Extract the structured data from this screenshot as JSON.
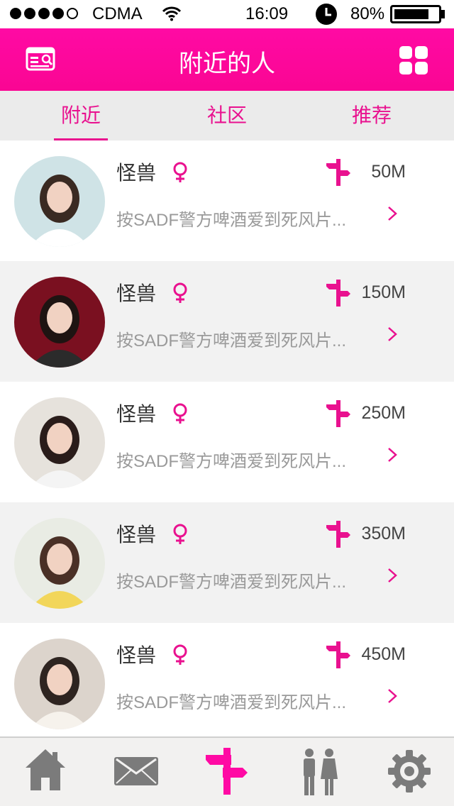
{
  "status_bar": {
    "carrier": "CDMA",
    "time": "16:09",
    "battery": "80%",
    "battery_level": 0.8,
    "signal_filled": 4,
    "signal_total": 5
  },
  "navbar": {
    "title": "附近的人",
    "left_icon": "id-card-icon",
    "right_icon": "grid-icon"
  },
  "tabs": [
    {
      "label": "附近",
      "active": true
    },
    {
      "label": "社区",
      "active": false
    },
    {
      "label": "推荐",
      "active": false
    }
  ],
  "list": [
    {
      "name": "怪兽",
      "gender": "female-icon",
      "distance": "50M",
      "desc": "按SADF警方啤酒爱到死风片..."
    },
    {
      "name": "怪兽",
      "gender": "female-icon",
      "distance": "150M",
      "desc": "按SADF警方啤酒爱到死风片..."
    },
    {
      "name": "怪兽",
      "gender": "female-icon",
      "distance": "250M",
      "desc": "按SADF警方啤酒爱到死风片..."
    },
    {
      "name": "怪兽",
      "gender": "female-icon",
      "distance": "350M",
      "desc": "按SADF警方啤酒爱到死风片..."
    },
    {
      "name": "怪兽",
      "gender": "female-icon",
      "distance": "450M",
      "desc": "按SADF警方啤酒爱到死风片..."
    }
  ],
  "tabbar": [
    {
      "icon": "home-icon",
      "active": false
    },
    {
      "icon": "mail-icon",
      "active": false
    },
    {
      "icon": "signpost-icon",
      "active": true
    },
    {
      "icon": "people-icon",
      "active": false
    },
    {
      "icon": "gear-icon",
      "active": false
    }
  ],
  "colors": {
    "accent": "#ff0aa4",
    "tab_text": "#e9118f",
    "inactive_icon": "#7b7b7b"
  }
}
